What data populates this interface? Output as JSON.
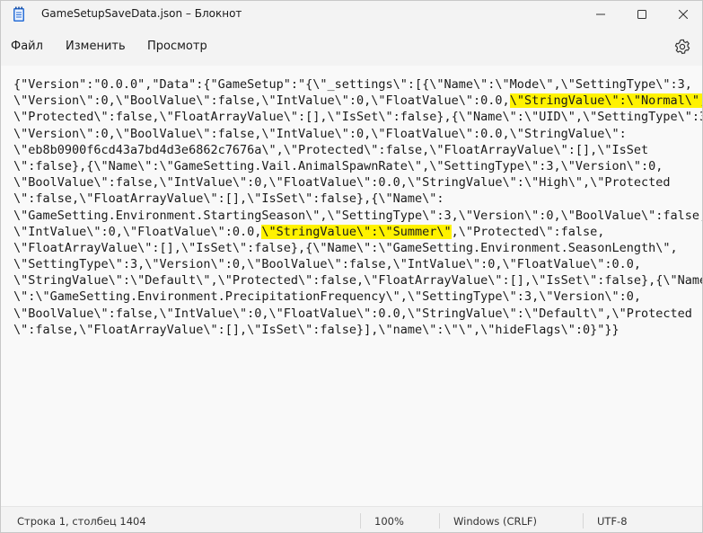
{
  "window": {
    "title": "GameSetupSaveData.json – Блокнот"
  },
  "menu": {
    "file": "Файл",
    "edit": "Изменить",
    "view": "Просмотр"
  },
  "editor": {
    "lines": [
      {
        "segments": [
          {
            "t": "{\"Version\":\"0.0.0\",\"Data\":{\"GameSetup\":\"{\\\"_settings\\\":[{\\\"Name\\\":\\\"Mode\\\",\\\"SettingType\\\":3,",
            "hl": false
          }
        ]
      },
      {
        "segments": [
          {
            "t": "\\\"Version\\\":0,\\\"BoolValue\\\":false,\\\"IntValue\\\":0,\\\"FloatValue\\\":0.0,",
            "hl": false
          },
          {
            "t": "\\\"StringValue\\\":\\\"Normal\\\",",
            "hl": true
          }
        ]
      },
      {
        "segments": [
          {
            "t": "\\\"Protected\\\":false,\\\"FloatArrayValue\\\":[],\\\"IsSet\\\":false},{\\\"Name\\\":\\\"UID\\\",\\\"SettingType\\\":3,",
            "hl": false
          }
        ]
      },
      {
        "segments": [
          {
            "t": "\\\"Version\\\":0,\\\"BoolValue\\\":false,\\\"IntValue\\\":0,\\\"FloatValue\\\":0.0,\\\"StringValue\\\":",
            "hl": false
          }
        ]
      },
      {
        "segments": [
          {
            "t": "\\\"eb8b0900f6cd43a7bd4d3e6862c7676a\\\",\\\"Protected\\\":false,\\\"FloatArrayValue\\\":[],\\\"IsSet",
            "hl": false
          }
        ]
      },
      {
        "segments": [
          {
            "t": "\\\":false},{\\\"Name\\\":\\\"GameSetting.Vail.AnimalSpawnRate\\\",\\\"SettingType\\\":3,\\\"Version\\\":0,",
            "hl": false
          }
        ]
      },
      {
        "segments": [
          {
            "t": "\\\"BoolValue\\\":false,\\\"IntValue\\\":0,\\\"FloatValue\\\":0.0,\\\"StringValue\\\":\\\"High\\\",\\\"Protected",
            "hl": false
          }
        ]
      },
      {
        "segments": [
          {
            "t": "\\\":false,\\\"FloatArrayValue\\\":[],\\\"IsSet\\\":false},{\\\"Name\\\":",
            "hl": false
          }
        ]
      },
      {
        "segments": [
          {
            "t": "\\\"GameSetting.Environment.StartingSeason\\\",\\\"SettingType\\\":3,\\\"Version\\\":0,\\\"BoolValue\\\":false,",
            "hl": false
          }
        ]
      },
      {
        "segments": [
          {
            "t": "\\\"IntValue\\\":0,\\\"FloatValue\\\":0.0,",
            "hl": false
          },
          {
            "t": "\\\"StringValue\\\":\\\"Summer\\\"",
            "hl": true
          },
          {
            "t": ",\\\"Protected\\\":false,",
            "hl": false
          }
        ]
      },
      {
        "segments": [
          {
            "t": "\\\"FloatArrayValue\\\":[],\\\"IsSet\\\":false},{\\\"Name\\\":\\\"GameSetting.Environment.SeasonLength\\\",",
            "hl": false
          }
        ]
      },
      {
        "segments": [
          {
            "t": "\\\"SettingType\\\":3,\\\"Version\\\":0,\\\"BoolValue\\\":false,\\\"IntValue\\\":0,\\\"FloatValue\\\":0.0,",
            "hl": false
          }
        ]
      },
      {
        "segments": [
          {
            "t": "\\\"StringValue\\\":\\\"Default\\\",\\\"Protected\\\":false,\\\"FloatArrayValue\\\":[],\\\"IsSet\\\":false},{\\\"Name",
            "hl": false
          }
        ]
      },
      {
        "segments": [
          {
            "t": "\\\":\\\"GameSetting.Environment.PrecipitationFrequency\\\",\\\"SettingType\\\":3,\\\"Version\\\":0,",
            "hl": false
          }
        ]
      },
      {
        "segments": [
          {
            "t": "\\\"BoolValue\\\":false,\\\"IntValue\\\":0,\\\"FloatValue\\\":0.0,\\\"StringValue\\\":\\\"Default\\\",\\\"Protected",
            "hl": false
          }
        ]
      },
      {
        "segments": [
          {
            "t": "\\\":false,\\\"FloatArrayValue\\\":[],\\\"IsSet\\\":false}],\\\"name\\\":\\\"\\\",\\\"hideFlags\\\":0}\"}}",
            "hl": false
          }
        ]
      }
    ],
    "highlight_color": "#fff200"
  },
  "statusbar": {
    "position": "Строка 1, столбец 1404",
    "zoom": "100%",
    "line_ending": "Windows (CRLF)",
    "encoding": "UTF-8"
  }
}
